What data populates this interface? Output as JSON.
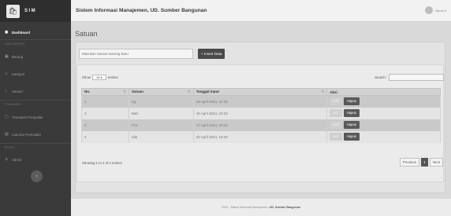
{
  "brand": {
    "logo_glyph": "🛍",
    "name": "SIM"
  },
  "sidebar": {
    "dashboard": "Dashboard",
    "heading_master": "DATA MASTER",
    "barang": "Barang",
    "kategori": "Kategori",
    "satuan": "Satuan",
    "heading_transaksi": "TRANSAKSI",
    "transaksi": "Transaksi Penjualan",
    "laporan": "Laporan Penjualan",
    "heading_profil": "PROFIL",
    "admin": "Admin",
    "toggle_glyph": "‹"
  },
  "topbar": {
    "title": "Sistem Informasi Manajemen, UD. Sumber Bangunan",
    "user": "Mimin ▾"
  },
  "page": {
    "title": "Satuan"
  },
  "form": {
    "placeholder": "Masukan Satuan Barang Baru",
    "insert_label": "+ Insert Data"
  },
  "table": {
    "show_label": "Show",
    "entries_value": "10 ▾",
    "entries_label": "entries",
    "search_label": "Search:",
    "headers": {
      "no": "No.",
      "satuan": "Satuan",
      "tanggal": "Tanggal Input",
      "aksi": "Aksi"
    },
    "rows": [
      {
        "no": "1",
        "satuan": "Kg",
        "tanggal": "16 April 2024, 22:23"
      },
      {
        "no": "2",
        "satuan": "Batt",
        "tanggal": "16 April 2024, 22:23"
      },
      {
        "no": "3",
        "satuan": "Pcs",
        "tanggal": "17 April 2024, 20:44"
      },
      {
        "no": "4",
        "satuan": "Zak",
        "tanggal": "25 April 2024, 18:39"
      }
    ],
    "edit_label": "Edit",
    "hapus_label": "Hapus",
    "info": "Showing 1 to 4 of 4 entries",
    "prev": "Previous",
    "current_page": "1",
    "next": "Next"
  },
  "footer": {
    "text": "2024 - Sistem Informasi Manajemen |",
    "brand": "UD. Sumber Bangunan"
  }
}
